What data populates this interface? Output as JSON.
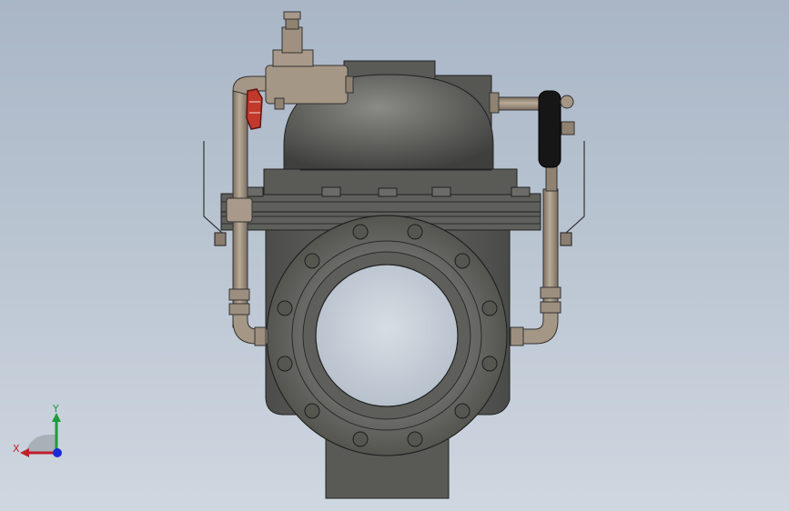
{
  "viewport": {
    "background_top": "#a9b6c6",
    "background_bottom": "#cfd7e0"
  },
  "model": {
    "body_color": "#5c5d59",
    "pipe_color": "#a59785",
    "handwheel_color": "#c0392b",
    "gauge_color": "#1a1a1a"
  },
  "triad": {
    "x_label": "X",
    "y_label": "Y",
    "x_color": "#c0202a",
    "y_color": "#1f9a3a",
    "z_color": "#1a2bd6"
  }
}
